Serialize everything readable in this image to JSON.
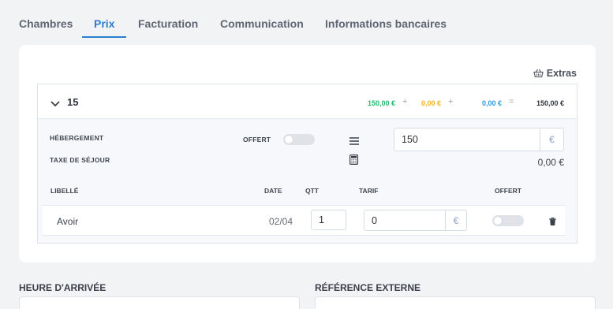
{
  "tabs": [
    {
      "label": "Chambres"
    },
    {
      "label": "Prix",
      "active": true
    },
    {
      "label": "Facturation"
    },
    {
      "label": "Communication"
    },
    {
      "label": "Informations bancaires"
    }
  ],
  "extras_label": "Extras",
  "room": {
    "number": "15",
    "amount_green": "150,00 €",
    "amount_orange": "0,00 €",
    "amount_blue": "0,00 €",
    "total": "150,00 €",
    "op_plus": "+",
    "op_eq": "="
  },
  "hebergement": {
    "label": "HÉBERGEMENT",
    "offert_label": "OFFERT",
    "offert": false,
    "price_value": "150",
    "currency": "€"
  },
  "taxe": {
    "label": "TAXE DE SÉJOUR",
    "value": "0,00 €"
  },
  "table": {
    "headers": {
      "libelle": "LIBELLÉ",
      "date": "DATE",
      "qtt": "QTT",
      "tarif": "TARIF",
      "offert": "OFFERT"
    },
    "rows": [
      {
        "libelle": "Avoir",
        "date": "02/04",
        "qtt": "1",
        "tarif": "0",
        "currency": "€",
        "offert": false
      }
    ]
  },
  "form": {
    "arrival_label": "HEURE D'ARRIVÉE",
    "external_ref_label": "RÉFÉRENCE EXTERNE"
  },
  "colors": {
    "accent": "#2a7ed0",
    "green": "#27b86a",
    "orange": "#f0b323",
    "blue": "#2b9be0"
  }
}
